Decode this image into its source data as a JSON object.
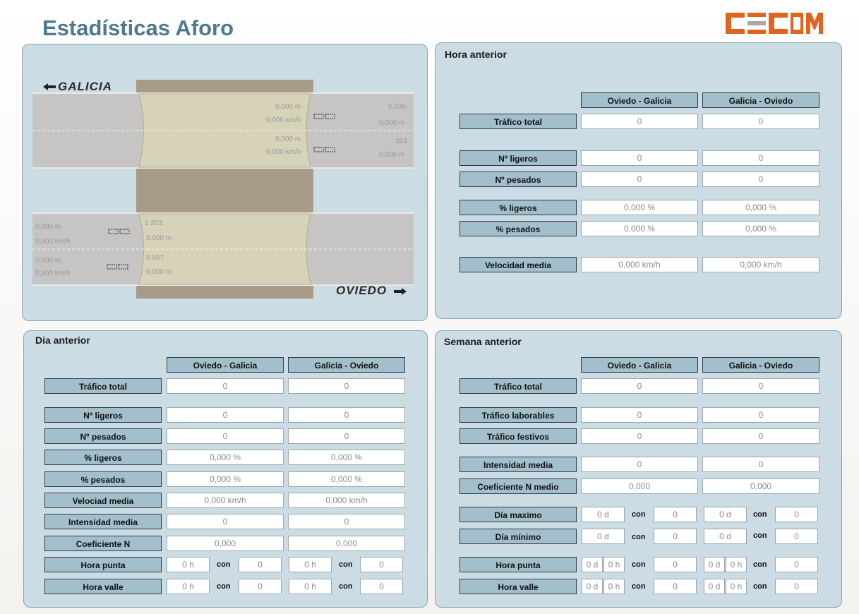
{
  "page_title": "Estadísticas Aforo",
  "logo_text": "CECOM",
  "colors": {
    "accent": "#e06420",
    "title": "#4d7a8c",
    "panel": "#ccdce4",
    "label_bg": "#a2bfcb"
  },
  "map": {
    "galicia_label": "GALICIA",
    "oviedo_label": "OVIEDO",
    "upper": {
      "lane1_dist": "0,000 m",
      "lane1_speed": "0,000 km/h",
      "lane1_count": "5.536",
      "lane1_right_dist": "0,000 m",
      "lane2_dist": "0,000 m",
      "lane2_speed": "0,000 km/h",
      "lane2_count": "324",
      "lane2_right_dist": "0,000 m"
    },
    "lower": {
      "lane1_dist": "0,000 m",
      "lane1_speed": "0,000 km/h",
      "lane1_count": "1.203",
      "lane1_right_dist": "0,000 m",
      "lane2_dist": "0,000 m",
      "lane2_speed": "0,000 km/h",
      "lane2_count": "9.697",
      "lane2_right_dist": "0,000 m"
    }
  },
  "hora_anterior": {
    "title": "Hora anterior",
    "col1": "Oviedo - Galicia",
    "col2": "Galicia - Oviedo",
    "rows": [
      {
        "label": "Tráfico total",
        "v1": "0",
        "v2": "0"
      },
      {
        "label": "Nº ligeros",
        "v1": "0",
        "v2": "0"
      },
      {
        "label": "Nº pesados",
        "v1": "0",
        "v2": "0"
      },
      {
        "label": "% ligeros",
        "v1": "0,000 %",
        "v2": "0,000 %"
      },
      {
        "label": "% pesados",
        "v1": "0,000 %",
        "v2": "0,000 %"
      },
      {
        "label": "Velocidad media",
        "v1": "0,000 km/h",
        "v2": "0,000 km/h"
      }
    ]
  },
  "dia_anterior": {
    "title": "Dia anterior",
    "col1": "Oviedo - Galicia",
    "col2": "Galicia - Oviedo",
    "rows": [
      {
        "label": "Tráfico total",
        "v1": "0",
        "v2": "0"
      },
      {
        "label": "Nº ligeros",
        "v1": "0",
        "v2": "0"
      },
      {
        "label": "Nº pesados",
        "v1": "0",
        "v2": "0"
      },
      {
        "label": "% ligeros",
        "v1": "0,000 %",
        "v2": "0,000 %"
      },
      {
        "label": "% pesados",
        "v1": "0,000 %",
        "v2": "0,000 %"
      },
      {
        "label": "Velociad media",
        "v1": "0,000 km/h",
        "v2": "0,000 km/h"
      },
      {
        "label": "Intensidad media",
        "v1": "0",
        "v2": "0"
      },
      {
        "label": "Coeficiente N",
        "v1": "0,000",
        "v2": "0,000"
      }
    ],
    "hora_punta": {
      "label": "Hora punta",
      "h1": "0 h",
      "c1": "0",
      "h2": "0 h",
      "c2": "0"
    },
    "hora_valle": {
      "label": "Hora valle",
      "h1": "0 h",
      "c1": "0",
      "h2": "0 h",
      "c2": "0"
    },
    "con": "con"
  },
  "semana_anterior": {
    "title": "Semana anterior",
    "col1": "Oviedo - Galicia",
    "col2": "Galicia - Oviedo",
    "rows": [
      {
        "label": "Tráfico total",
        "v1": "0",
        "v2": "0"
      },
      {
        "label": "Tráfico laborables",
        "v1": "0",
        "v2": "0"
      },
      {
        "label": "Tráfico festivos",
        "v1": "0",
        "v2": "0"
      },
      {
        "label": "Intensidad media",
        "v1": "0",
        "v2": "0"
      },
      {
        "label": "Coeficiente N medio",
        "v1": "0,000",
        "v2": "0,000"
      }
    ],
    "dia_maximo": {
      "label": "Día maximo",
      "d1": "0 d",
      "c1": "0",
      "d2": "0 d",
      "c2": "0"
    },
    "dia_minimo": {
      "label": "Día mínimo",
      "d1": "0 d",
      "c1": "0",
      "d2": "0 d",
      "c2": "0"
    },
    "hora_punta": {
      "label": "Hora punta",
      "d1": "0 d",
      "h1": "0 h",
      "c1": "0",
      "d2": "0 d",
      "h2": "0 h",
      "c2": "0"
    },
    "hora_valle": {
      "label": "Hora valle",
      "d1": "0 d",
      "h1": "0 h",
      "c1": "0",
      "d2": "0 d",
      "h2": "0 h",
      "c2": "0"
    },
    "con": "con"
  }
}
